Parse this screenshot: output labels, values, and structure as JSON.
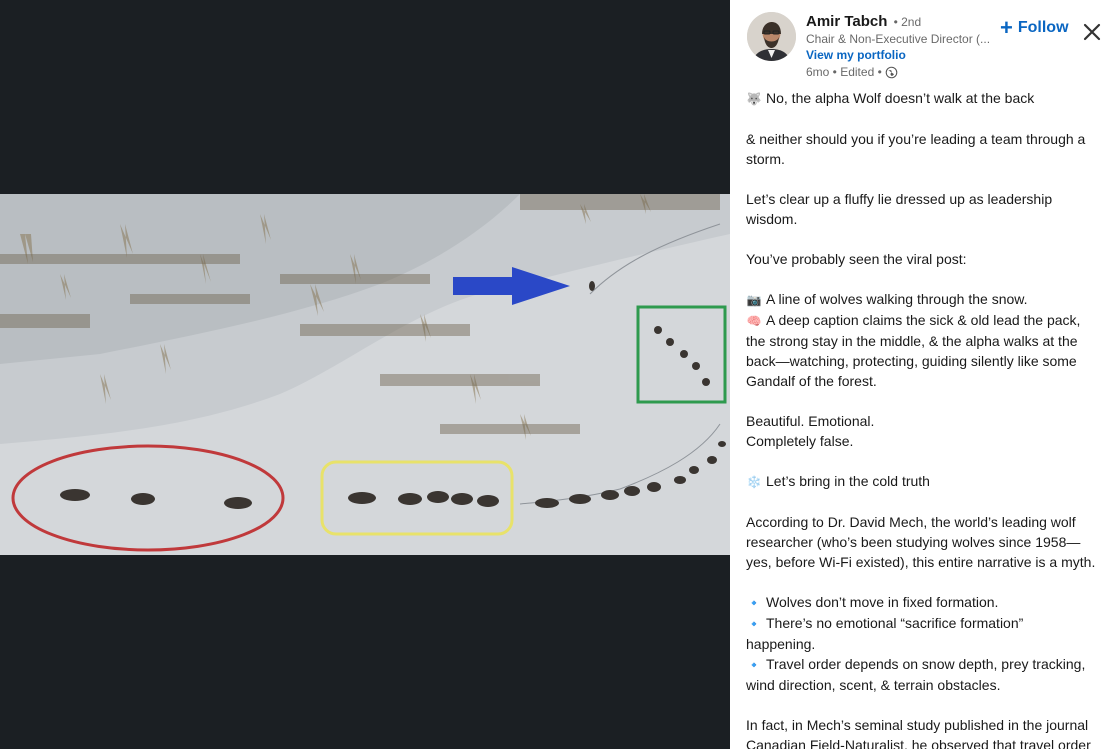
{
  "post": {
    "author": "Amir Tabch",
    "degree": "• 2nd",
    "headline": "Chair & Non-Executive Director (...",
    "portfolio_link": "View my portfolio",
    "meta_time": "6mo • Edited •",
    "follow_label": "Follow"
  },
  "content": {
    "p1": "No, the alpha Wolf doesn’t walk at the back",
    "p1_icon": "🐺",
    "p2": "& neither should you if you’re leading a team through a storm.",
    "p3": "Let’s clear up a fluffy lie dressed up as leadership wisdom.",
    "p4": "You’ve probably seen the viral post:",
    "p5a_icon": "📷",
    "p5a": "A line of wolves walking through the snow.",
    "p5b_icon": "🧠",
    "p5b": "A deep caption claims the sick & old lead the pack, the strong stay in the middle, & the alpha walks at the back—watching, protecting, guiding silently like some Gandalf of the forest.",
    "p6a": "Beautiful. Emotional.",
    "p6b": "Completely false.",
    "p7_icon": "❄️",
    "p7": "Let’s bring in the cold truth",
    "p8": "According to Dr. David Mech, the world’s leading wolf researcher (who’s been studying wolves since 1958—yes, before Wi-Fi existed), this entire narrative is a myth.",
    "b_icon": "🔹",
    "b1": "Wolves don’t move in fixed formation.",
    "b2": "There’s no emotional “sacrifice formation” happening.",
    "b3": "Travel order depends on snow depth, prey tracking, wind direction, scent, & terrain obstacles.",
    "p9": "In fact, in Mech’s seminal study published in the journal Canadian Field-Naturalist, he observed that travel order"
  },
  "colors": {
    "link": "#0a66c2",
    "stage_bg": "#1b1f23"
  }
}
